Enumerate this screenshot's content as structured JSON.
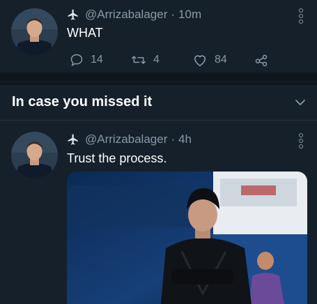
{
  "tweets": [
    {
      "handle": "@Arrizabalager",
      "separator": "·",
      "time": "10m",
      "text": "WHAT",
      "actions": {
        "replies": "14",
        "retweets": "4",
        "likes": "84"
      }
    },
    {
      "handle": "@Arrizabalager",
      "separator": "·",
      "time": "4h",
      "text": "Trust the process."
    }
  ],
  "section": {
    "title": "In case you missed it"
  },
  "colors": {
    "background": "#15202b",
    "secondary_text": "#8899a6",
    "divider": "#2a3540"
  }
}
